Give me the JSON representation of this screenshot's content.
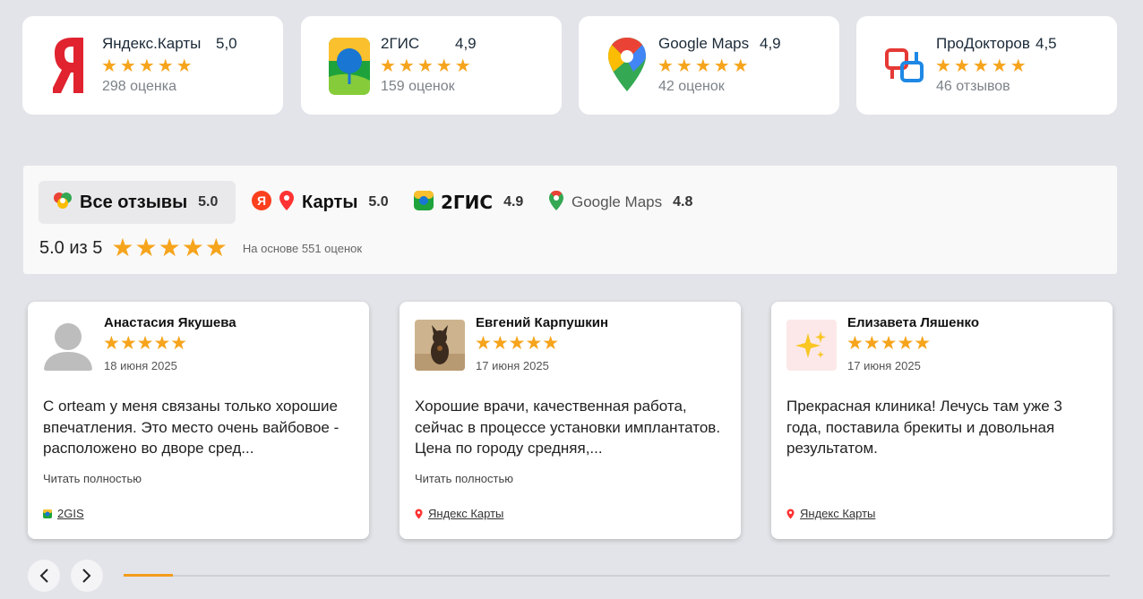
{
  "rating_cards": [
    {
      "name": "Яндекс.Карты",
      "score": "5,0",
      "stars": "★★★★★",
      "count": "298 оценка",
      "icon": "yandex-maps-logo"
    },
    {
      "name": "2ГИС",
      "score": "4,9",
      "stars": "★★★★★",
      "count": "159 оценок",
      "icon": "2gis-logo"
    },
    {
      "name": "Google Maps",
      "score": "4,9",
      "stars": "★★★★★",
      "count": "42 оценок",
      "icon": "google-maps-logo"
    },
    {
      "name": "ПроДокторов",
      "score": "4,5",
      "stars": "★★★★★",
      "count": "46 отзывов",
      "icon": "prodoctorov-logo"
    }
  ],
  "filter": {
    "tabs": [
      {
        "label": "Все отзывы",
        "score": "5.0",
        "active": true
      },
      {
        "label": "Карты",
        "score": "5.0"
      },
      {
        "label": "2ГИС",
        "score": "4.9"
      },
      {
        "label": "Google Maps",
        "score": "4.8"
      }
    ],
    "summary": "5.0 из 5",
    "summary_stars": "★★★★★",
    "basis": "На основе 551 оценок"
  },
  "reviews": [
    {
      "name": "Анастасия Якушева",
      "stars": "★★★★★",
      "date": "18 июня 2025",
      "text": "С orteam у меня связаны только хорошие впечатления. Это место очень вайбовое - расположено во дворе сред...",
      "more": "Читать полностью",
      "source": "2GIS"
    },
    {
      "name": "Евгений Карпушкин",
      "stars": "★★★★★",
      "date": "17 июня 2025",
      "text": "Хорошие врачи, качественная работа, сейчас в процессе установки имплантатов. Цена по городу средняя,...",
      "more": "Читать полностью",
      "source": "Яндекс Карты"
    },
    {
      "name": "Елизавета Ляшенко",
      "stars": "★★★★★",
      "date": "17 июня 2025",
      "text": "Прекрасная клиника! Лечусь там уже 3 года, поставила брекиты и довольная результатом.",
      "source": "Яндекс Карты"
    }
  ],
  "nav": {
    "prev": "‹",
    "next": "›",
    "progress": 0.05
  },
  "colors": {
    "star": "#f6a41c",
    "background": "#e3e4e9",
    "progress": "#f39c1b"
  }
}
